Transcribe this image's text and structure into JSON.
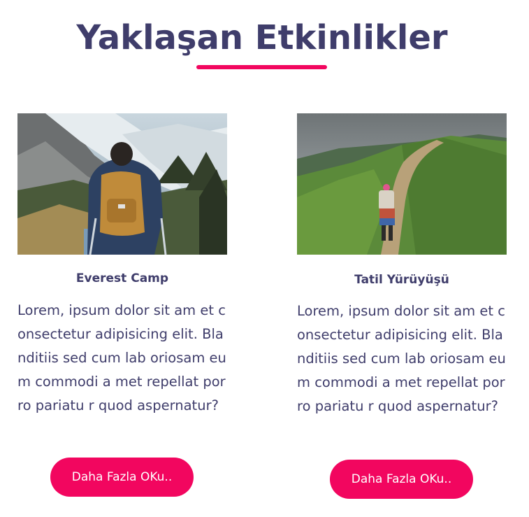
{
  "section": {
    "title": "Yaklaşan Etkinlikler",
    "accent_color": "#f2065f",
    "text_color": "#3f3d6b"
  },
  "events": [
    {
      "name": "Everest Camp",
      "image": "hiker-with-backpack-snowy-mountains-photo",
      "description": "Lorem, ipsum dolor sit am et consectetur adipisicing elit. Blanditiis sed cum lab oriosam eum commodi a met repellat porro pariatu r quod aspernatur?",
      "button_label": "Daha Fazla OKu.."
    },
    {
      "name": "Tatil Yürüyüşü",
      "image": "hiker-on-green-ridge-trail-photo",
      "description": "Lorem, ipsum dolor sit am et consectetur adipisicing elit. Blanditiis sed cum lab oriosam eum commodi a met repellat porro pariatu r quod aspernatur?",
      "button_label": "Daha Fazla OKu.."
    }
  ]
}
